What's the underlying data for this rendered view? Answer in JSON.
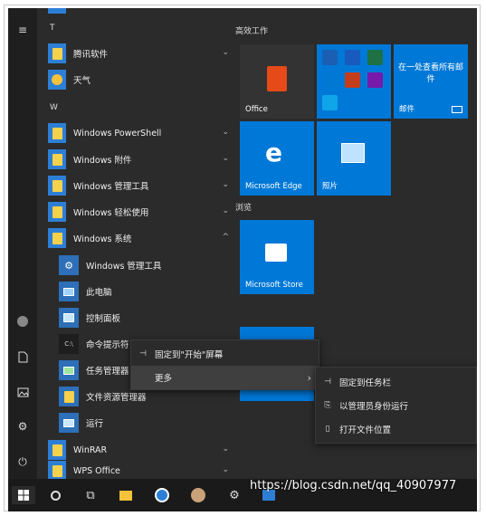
{
  "letters": {
    "t": "T",
    "w": "W"
  },
  "apps": [
    {
      "label": "腾讯软件",
      "chevron": "⌄"
    },
    {
      "label": "天气"
    },
    {
      "label": "Windows PowerShell",
      "chevron": "⌄"
    },
    {
      "label": "Windows 附件",
      "chevron": "⌄"
    },
    {
      "label": "Windows 管理工具",
      "chevron": "⌄"
    },
    {
      "label": "Windows 轻松使用",
      "chevron": "⌄"
    },
    {
      "label": "Windows 系统",
      "chevron": "^"
    }
  ],
  "subapps": [
    {
      "label": "Windows 管理工具",
      "icon": "admin-tools-icon"
    },
    {
      "label": "此电脑",
      "icon": "this-pc-icon"
    },
    {
      "label": "控制面板",
      "icon": "control-panel-icon"
    },
    {
      "label": "命令提示符",
      "icon": "cmd-icon"
    },
    {
      "label": "任务管理器",
      "icon": "task-manager-icon"
    },
    {
      "label": "文件资源管理器",
      "icon": "file-explorer-icon"
    },
    {
      "label": "运行",
      "icon": "run-icon"
    }
  ],
  "apps_bottom": [
    {
      "label": "WinRAR",
      "chevron": "⌄"
    },
    {
      "label": "WPS Office",
      "chevron": "⌄"
    }
  ],
  "tiles": {
    "group1": "高效工作",
    "group2": "浏览",
    "office": "Office",
    "mail_promo": "在一处查看所有邮件",
    "mail": "邮件",
    "edge": "Microsoft Edge",
    "photos": "照片",
    "store": "Microsoft Store"
  },
  "context_menu": {
    "pin_start": "固定到\"开始\"屏幕",
    "more": "更多"
  },
  "submenu": {
    "pin_taskbar": "固定到任务栏",
    "run_admin": "以管理员身份运行",
    "open_location": "打开文件位置"
  },
  "watermark": "https://blog.csdn.net/qq_40907977",
  "colors": {
    "accent": "#0078d7",
    "office": "#e64a19",
    "background": "#2b2b2b"
  }
}
